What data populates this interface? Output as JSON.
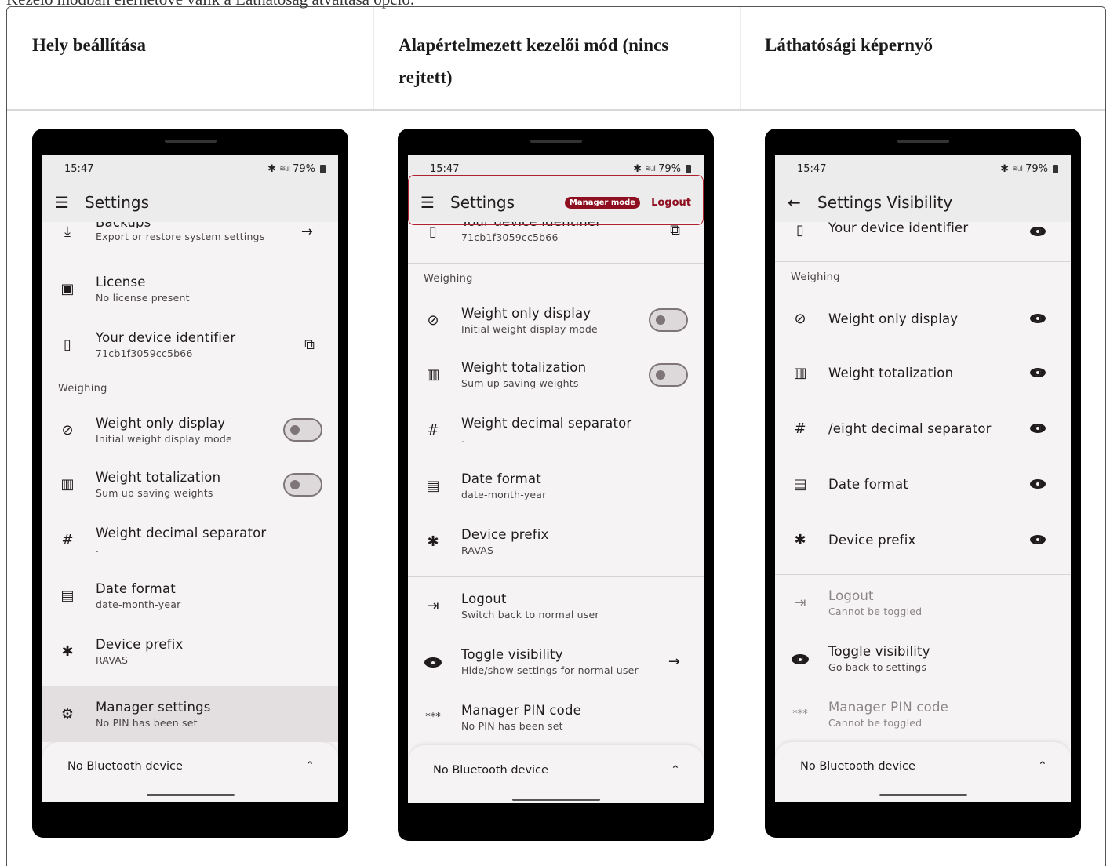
{
  "caption": "Kezelő módban elérhetővé válik a Láthatóság átváltása opció.",
  "columns": [
    {
      "header": "Hely beállítása"
    },
    {
      "header": "Alapértelmezett kezelői mód (nincs rejtett)"
    },
    {
      "header": "Láthatósági képernyő"
    }
  ],
  "status": {
    "time": "15:47",
    "battery": "79%"
  },
  "p1": {
    "title": "Settings",
    "partial_title": "Backups",
    "items": [
      {
        "title": "Export or restore system settings"
      },
      {
        "title": "License",
        "sub": "No license present"
      },
      {
        "title": "Your device identifier",
        "sub": "71cb1f3059cc5b66"
      },
      {
        "section": "Weighing"
      },
      {
        "title": "Weight only display",
        "sub": "Initial weight display mode"
      },
      {
        "title": "Weight totalization",
        "sub": "Sum up saving weights"
      },
      {
        "title": "Weight decimal separator",
        "sub": "."
      },
      {
        "title": "Date format",
        "sub": "date-month-year"
      },
      {
        "title": "Device prefix",
        "sub": "RAVAS"
      },
      {
        "title": "Manager settings",
        "sub": "No PIN has been set"
      }
    ],
    "bt": "No Bluetooth device"
  },
  "p2": {
    "title": "Settings",
    "badge": "Manager mode",
    "logout": "Logout",
    "partial_title": "Your device identifier",
    "items": [
      {
        "sub": "71cb1f3059cc5b66"
      },
      {
        "section": "Weighing"
      },
      {
        "title": "Weight only display",
        "sub": "Initial weight display mode"
      },
      {
        "title": "Weight totalization",
        "sub": "Sum up saving weights"
      },
      {
        "title": "Weight decimal separator",
        "sub": "."
      },
      {
        "title": "Date format",
        "sub": "date-month-year"
      },
      {
        "title": "Device prefix",
        "sub": "RAVAS"
      },
      {
        "title": "Logout",
        "sub": "Switch back to normal user"
      },
      {
        "title": "Toggle visibility",
        "sub": "Hide/show settings for normal user"
      },
      {
        "title": "Manager PIN code",
        "sub": "No PIN has been set"
      }
    ],
    "bt": "No Bluetooth device"
  },
  "p3": {
    "title": "Settings Visibility",
    "items": [
      {
        "title": "Your device identifier"
      },
      {
        "section": "Weighing"
      },
      {
        "title": "Weight only display"
      },
      {
        "title": "Weight totalization"
      },
      {
        "title": "/eight decimal separator"
      },
      {
        "title": "Date format"
      },
      {
        "title": "Device prefix"
      },
      {
        "title": "Logout",
        "sub": "Cannot be toggled"
      },
      {
        "title": "Toggle visibility",
        "sub": "Go back to settings"
      },
      {
        "title": "Manager PIN code",
        "sub": "Cannot be toggled"
      }
    ],
    "bt": "No Bluetooth device"
  }
}
